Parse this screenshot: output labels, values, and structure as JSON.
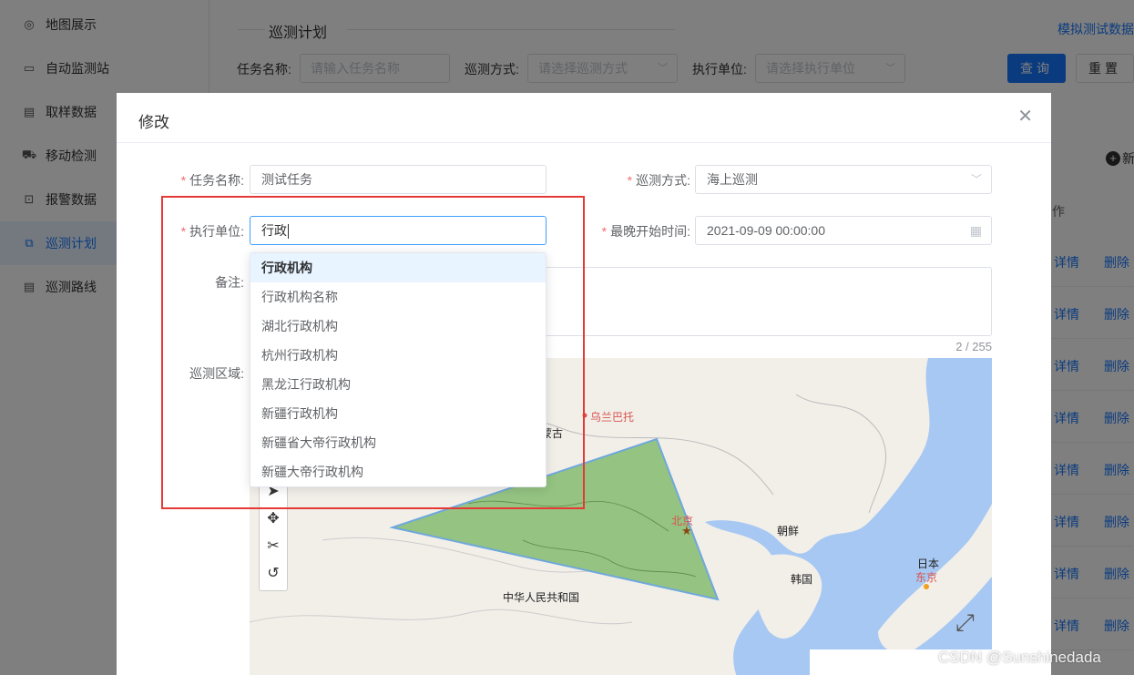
{
  "sidebar": {
    "items": [
      {
        "label": "地图展示",
        "icon": "globe-icon"
      },
      {
        "label": "自动监测站",
        "icon": "monitor-icon"
      },
      {
        "label": "取样数据",
        "icon": "document-icon"
      },
      {
        "label": "移动检测",
        "icon": "vehicle-icon"
      },
      {
        "label": "报警数据",
        "icon": "alarm-icon"
      },
      {
        "label": "巡测计划",
        "icon": "plan-icon",
        "active": true
      },
      {
        "label": "巡测路线",
        "icon": "route-icon"
      }
    ]
  },
  "panel": {
    "title": "巡测计划",
    "sim_link": "模拟测试数据",
    "filters": {
      "task_label": "任务名称:",
      "task_placeholder": "请输入任务名称",
      "mode_label": "巡测方式:",
      "mode_placeholder": "请选择巡测方式",
      "unit_label": "执行单位:",
      "unit_placeholder": "请选择执行单位"
    },
    "query_btn": "查询",
    "reset_btn": "重置",
    "add_btn": "新",
    "op_col": "作",
    "row_detail": "详情",
    "row_delete": "删除"
  },
  "dialog": {
    "title": "修改",
    "close": "✕",
    "task_name_label": "任务名称:",
    "task_name_value": "测试任务",
    "patrol_mode_label": "巡测方式:",
    "patrol_mode_value": "海上巡测",
    "exec_unit_label": "执行单位:",
    "exec_unit_value": "行政",
    "latest_start_label": "最晚开始时间:",
    "latest_start_value": "2021-09-09 00:00:00",
    "remark_label": "备注:",
    "remark_counter": "2 / 255",
    "region_label": "巡测区域:"
  },
  "dropdown": {
    "options": [
      "行政机构",
      "行政机构名称",
      "湖北行政机构",
      "杭州行政机构",
      "黑龙江行政机构",
      "新疆行政机构",
      "新疆省大帝行政机构",
      "新疆大帝行政机构"
    ]
  },
  "map": {
    "labels": {
      "ulaanbaatar": "乌兰巴托",
      "mongolia": "蒙古",
      "beijing": "北京",
      "korea_north": "朝鲜",
      "korea_south": "韩国",
      "japan": "日本",
      "tokyo": "东京",
      "china": "中华人民共和国"
    },
    "polygon_color": "#8ec07c",
    "water_color": "#a7c8f2"
  },
  "watermark": "CSDN @Sunshinedada"
}
